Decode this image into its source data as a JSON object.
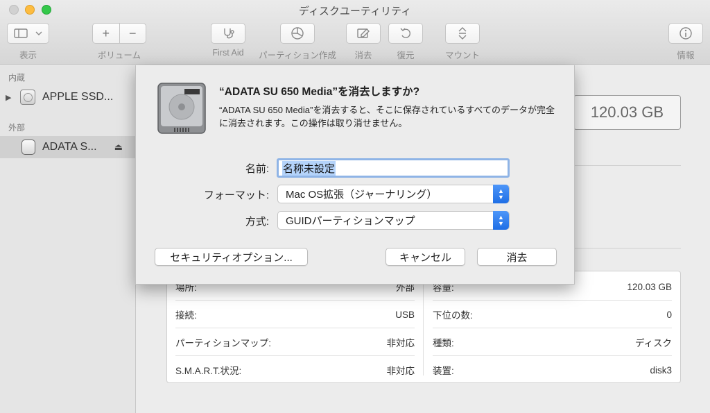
{
  "window": {
    "title": "ディスクユーティリティ"
  },
  "toolbar": {
    "view_label": "表示",
    "volume_label": "ボリューム",
    "firstaid_label": "First Aid",
    "partition_label": "パーティション作成",
    "erase_label": "消去",
    "restore_label": "復元",
    "mount_label": "マウント",
    "info_label": "情報"
  },
  "sidebar": {
    "internal_header": "内蔵",
    "external_header": "外部",
    "internal_item": "APPLE SSD...",
    "external_item": "ADATA S..."
  },
  "main": {
    "capacity": "120.03 GB",
    "info": {
      "left": [
        {
          "label": "場所:",
          "value": "外部"
        },
        {
          "label": "接続:",
          "value": "USB"
        },
        {
          "label": "パーティションマップ:",
          "value": "非対応"
        },
        {
          "label": "S.M.A.R.T.状況:",
          "value": "非対応"
        }
      ],
      "right": [
        {
          "label": "容量:",
          "value": "120.03 GB"
        },
        {
          "label": "下位の数:",
          "value": "0"
        },
        {
          "label": "種類:",
          "value": "ディスク"
        },
        {
          "label": "装置:",
          "value": "disk3"
        }
      ]
    }
  },
  "sheet": {
    "title": "“ADATA SU 650 Media”を消去しますか?",
    "message": "“ADATA SU 650 Media”を消去すると、そこに保存されているすべてのデータが完全に消去されます。この操作は取り消せません。",
    "name_label": "名前:",
    "name_value": "名称未設定",
    "format_label": "フォーマット:",
    "format_value": "Mac OS拡張（ジャーナリング）",
    "scheme_label": "方式:",
    "scheme_value": "GUIDパーティションマップ",
    "security_button": "セキュリティオプション...",
    "cancel_button": "キャンセル",
    "erase_button": "消去"
  }
}
